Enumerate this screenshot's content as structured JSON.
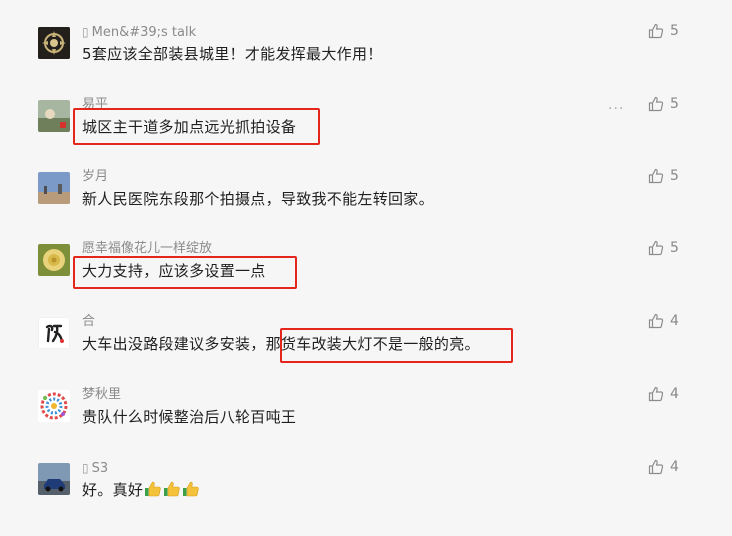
{
  "comments": [
    {
      "name": "Men&#39;s talk",
      "text": "5套应该全部装县城里！才能发挥最大作用！",
      "likes": "5",
      "avatar_icon": "ornament-avatar"
    },
    {
      "name": "易平",
      "text": "城区主干道多加点远光抓拍设备",
      "likes": "5",
      "avatar_icon": "landscape-avatar",
      "more": "···"
    },
    {
      "name": "岁月",
      "text": "新人民医院东段那个拍摄点，导致我不能左转回家。",
      "likes": "5",
      "avatar_icon": "sky-avatar"
    },
    {
      "name": "愿幸福像花儿一样绽放",
      "text": "大力支持，应该多设置一点",
      "likes": "5",
      "avatar_icon": "flower-avatar"
    },
    {
      "name": "合",
      "text": "大车出没路段建议多安装，那货车改装大灯不是一般的亮。",
      "likes": "4",
      "avatar_icon": "calligraphy-avatar"
    },
    {
      "name": "梦秋里",
      "text": "贵队什么时候整治后八轮百吨王",
      "likes": "4",
      "avatar_icon": "papercut-avatar"
    },
    {
      "name": "S3",
      "text": "好。真好",
      "likes": "4",
      "avatar_icon": "car-avatar",
      "emoji": "thumbs-up-emoji x3"
    }
  ],
  "colors": {
    "highlight_box": "#e4261c",
    "background": "#f6f6f6"
  }
}
